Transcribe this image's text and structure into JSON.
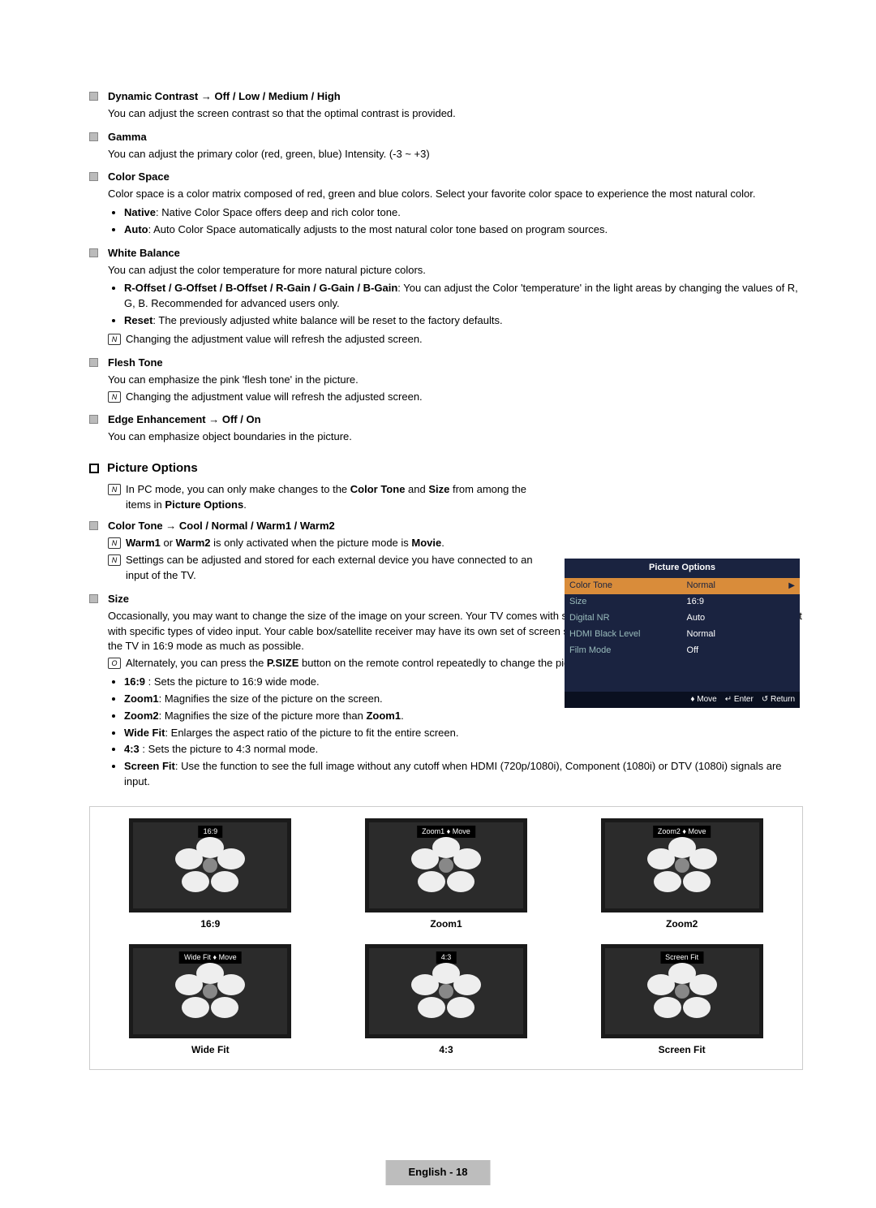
{
  "items": [
    {
      "label": "Dynamic Contrast → Off / Low / Medium / High",
      "desc": "You can adjust the screen contrast so that the optimal contrast is provided."
    },
    {
      "label": "Gamma",
      "desc": "You can adjust the primary color (red, green, blue) Intensity. (-3 ~ +3)"
    },
    {
      "label": "Color Space",
      "desc": "Color space is a color matrix composed of red, green and blue colors. Select your favorite color space to experience the most natural color.",
      "bullets": [
        {
          "b": "Native",
          "t": ": Native Color Space offers deep and rich color tone."
        },
        {
          "b": "Auto",
          "t": ": Auto Color Space automatically adjusts to the most natural color tone based on program sources."
        }
      ]
    },
    {
      "label": "White Balance",
      "desc": "You can adjust the color temperature for more natural picture colors.",
      "bullets": [
        {
          "b": "R-Offset / G-Offset / B-Offset / R-Gain / G-Gain / B-Gain",
          "t": ": You can adjust the Color 'temperature' in the light areas by changing the values of R, G, B. Recommended for advanced users only."
        },
        {
          "b": "Reset",
          "t": ": The previously adjusted white balance will be reset to the factory defaults."
        }
      ],
      "note": "Changing the adjustment value will refresh the adjusted screen."
    },
    {
      "label": "Flesh Tone",
      "desc": "You can emphasize the pink 'flesh tone' in the picture.",
      "note": "Changing the adjustment value will refresh the adjusted screen."
    },
    {
      "label": "Edge Enhancement → Off / On",
      "desc": "You can emphasize object boundaries in the picture."
    }
  ],
  "section2": {
    "title": "Picture Options",
    "note1a": "In PC mode, you can only make changes to the ",
    "note1b": "Color Tone",
    "note1c": " and ",
    "note1d": "Size",
    "note1e": " from among the items in ",
    "note1f": "Picture Options",
    "note1g": ".",
    "items": [
      {
        "label": "Color Tone → Cool / Normal / Warm1 / Warm2",
        "notes": [
          {
            "pre": "",
            "b1": "Warm1",
            "mid": " or ",
            "b2": "Warm2",
            "post": " is only activated when the picture mode is ",
            "b3": "Movie",
            "end": "."
          },
          {
            "plain": "Settings can be adjusted and stored for each external device you have connected to an input of the TV."
          }
        ]
      }
    ],
    "size": {
      "label": "Size",
      "desc": "Occasionally, you may want to change the size of the image on your screen. Your TV comes with six screen size options, each designed to work best with specific types of video input. Your cable box/satellite receiver may have its own set of screen sizes as well. In general, though, you should view the TV in 16:9 mode as much as possible.",
      "remoteNotePre": "Alternately, you can press the ",
      "remoteNoteB": "P.SIZE",
      "remoteNotePost": " button on the remote control repeatedly to change the picture size.",
      "bullets": [
        {
          "b": "16:9",
          "t": " : Sets the picture to 16:9 wide mode."
        },
        {
          "b": "Zoom1",
          "t": ": Magnifies the size of the picture on the screen."
        },
        {
          "b": "Zoom2",
          "t": ": Magnifies the size of the picture more than ",
          "b2": "Zoom1",
          "t2": "."
        },
        {
          "b": "Wide Fit",
          "t": ": Enlarges the aspect ratio of the picture to fit the entire screen."
        },
        {
          "b": "4:3",
          "t": " : Sets the picture to 4:3 normal mode."
        },
        {
          "b": "Screen Fit",
          "t": ": Use the function to see the full image without any cutoff when HDMI (720p/1080i), Component (1080i) or DTV (1080i) signals are input."
        }
      ]
    }
  },
  "osd": {
    "title": "Picture Options",
    "rows": [
      {
        "k": "Color Tone",
        "v": "Normal",
        "sel": true
      },
      {
        "k": "Size",
        "v": "16:9"
      },
      {
        "k": "Digital NR",
        "v": "Auto"
      },
      {
        "k": "HDMI Black Level",
        "v": "Normal"
      },
      {
        "k": "Film Mode",
        "v": "Off"
      }
    ],
    "foot": {
      "move": "Move",
      "enter": "Enter",
      "ret": "Return"
    }
  },
  "gallery": [
    {
      "bar": "16:9",
      "cap": "16:9"
    },
    {
      "bar": "Zoom1 ♦ Move",
      "cap": "Zoom1"
    },
    {
      "bar": "Zoom2 ♦ Move",
      "cap": "Zoom2"
    },
    {
      "bar": "Wide Fit ♦ Move",
      "cap": "Wide Fit"
    },
    {
      "bar": "4:3",
      "cap": "4:3"
    },
    {
      "bar": "Screen Fit",
      "cap": "Screen Fit"
    }
  ],
  "pageNum": "English - 18",
  "noteIcon": "N",
  "remoteIcon": "O"
}
